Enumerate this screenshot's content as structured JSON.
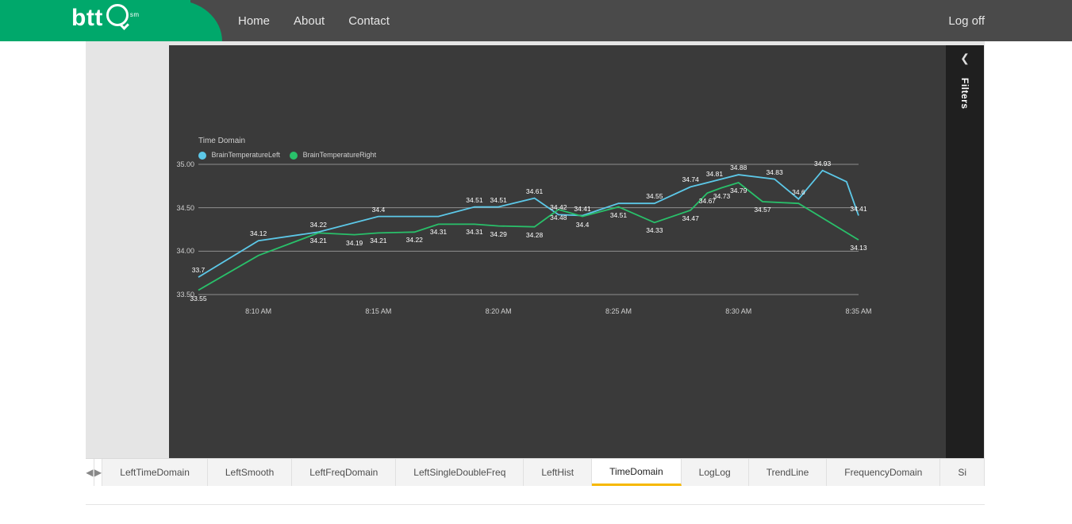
{
  "brand": {
    "text": "btt",
    "mark": "sm"
  },
  "nav": {
    "home": "Home",
    "about": "About",
    "contact": "Contact",
    "logoff": "Log off"
  },
  "filters": {
    "label": "Filters"
  },
  "tabs": {
    "items": [
      "LeftTimeDomain",
      "LeftSmooth",
      "LeftFreqDomain",
      "LeftSingleDoubleFreq",
      "LeftHist",
      "TimeDomain",
      "LogLog",
      "TrendLine",
      "FrequencyDomain",
      "Si"
    ],
    "active_index": 5
  },
  "chart_data": {
    "type": "line",
    "title": "Time Domain",
    "xlabel": "",
    "ylabel": "",
    "categories": [
      "8:10 AM",
      "8:15 AM",
      "8:20 AM",
      "8:25 AM",
      "8:30 AM",
      "8:35 AM"
    ],
    "x_minutes": [
      490,
      495,
      500,
      505,
      510,
      515
    ],
    "ylim": [
      33.5,
      35.0
    ],
    "yticks": [
      33.5,
      34.0,
      34.5,
      35.0
    ],
    "colors": {
      "BrainTemperatureLeft": "#5cc8e8",
      "BrainTemperatureRight": "#29c06a"
    },
    "series": [
      {
        "name": "BrainTemperatureLeft",
        "x": [
          487.5,
          490,
          492.5,
          495,
          497.5,
          499,
          500,
          501.5,
          502.5,
          503.5,
          505,
          506.5,
          508,
          509,
          510,
          511.5,
          512.5,
          513.5,
          514.5,
          515
        ],
        "values": [
          33.7,
          34.12,
          34.22,
          34.4,
          34.4,
          34.51,
          34.51,
          34.61,
          34.42,
          34.41,
          34.55,
          34.55,
          34.74,
          34.81,
          34.88,
          34.83,
          34.6,
          34.93,
          34.8,
          34.41
        ]
      },
      {
        "name": "BrainTemperatureRight",
        "x": [
          487.5,
          490,
          492.5,
          494,
          495,
          496.5,
          497.5,
          499,
          500,
          501.5,
          502.5,
          503.5,
          505,
          506.5,
          508,
          508.7,
          509.3,
          510,
          511,
          512.5,
          515
        ],
        "values": [
          33.55,
          33.95,
          34.21,
          34.19,
          34.21,
          34.22,
          34.31,
          34.31,
          34.29,
          34.28,
          34.48,
          34.4,
          34.51,
          34.33,
          34.47,
          34.67,
          34.73,
          34.79,
          34.57,
          34.55,
          34.13
        ]
      }
    ],
    "data_labels": [
      {
        "series": 0,
        "x": 487.5,
        "y": 33.7,
        "text": "33.7"
      },
      {
        "series": 0,
        "x": 490,
        "y": 34.12,
        "text": "34.12"
      },
      {
        "series": 0,
        "x": 492.5,
        "y": 34.22,
        "text": "34.22"
      },
      {
        "series": 0,
        "x": 495,
        "y": 34.4,
        "text": "34.4"
      },
      {
        "series": 0,
        "x": 499,
        "y": 34.51,
        "text": "34.51"
      },
      {
        "series": 0,
        "x": 500,
        "y": 34.51,
        "text": "34.51"
      },
      {
        "series": 0,
        "x": 501.5,
        "y": 34.61,
        "text": "34.61"
      },
      {
        "series": 0,
        "x": 502.5,
        "y": 34.42,
        "text": "34.42"
      },
      {
        "series": 0,
        "x": 503.5,
        "y": 34.41,
        "text": "34.41"
      },
      {
        "series": 0,
        "x": 506.5,
        "y": 34.55,
        "text": "34.55"
      },
      {
        "series": 0,
        "x": 508,
        "y": 34.74,
        "text": "34.74"
      },
      {
        "series": 0,
        "x": 509,
        "y": 34.81,
        "text": "34.81"
      },
      {
        "series": 0,
        "x": 510,
        "y": 34.88,
        "text": "34.88"
      },
      {
        "series": 0,
        "x": 511.5,
        "y": 34.83,
        "text": "34.83"
      },
      {
        "series": 0,
        "x": 512.5,
        "y": 34.6,
        "text": "34.6"
      },
      {
        "series": 0,
        "x": 513.5,
        "y": 34.93,
        "text": "34.93"
      },
      {
        "series": 0,
        "x": 515,
        "y": 34.41,
        "text": "34.41"
      },
      {
        "series": 1,
        "x": 487.5,
        "y": 33.55,
        "text": "33.55"
      },
      {
        "series": 1,
        "x": 492.5,
        "y": 34.21,
        "text": "34.21"
      },
      {
        "series": 1,
        "x": 494,
        "y": 34.19,
        "text": "34.19"
      },
      {
        "series": 1,
        "x": 495,
        "y": 34.21,
        "text": "34.21"
      },
      {
        "series": 1,
        "x": 496.5,
        "y": 34.22,
        "text": "34.22"
      },
      {
        "series": 1,
        "x": 497.5,
        "y": 34.31,
        "text": "34.31"
      },
      {
        "series": 1,
        "x": 499,
        "y": 34.31,
        "text": "34.31"
      },
      {
        "series": 1,
        "x": 500,
        "y": 34.29,
        "text": "34.29"
      },
      {
        "series": 1,
        "x": 501.5,
        "y": 34.28,
        "text": "34.28"
      },
      {
        "series": 1,
        "x": 502.5,
        "y": 34.48,
        "text": "34.48"
      },
      {
        "series": 1,
        "x": 503.5,
        "y": 34.4,
        "text": "34.4"
      },
      {
        "series": 1,
        "x": 505,
        "y": 34.51,
        "text": "34.51"
      },
      {
        "series": 1,
        "x": 506.5,
        "y": 34.33,
        "text": "34.33"
      },
      {
        "series": 1,
        "x": 508,
        "y": 34.47,
        "text": "34.47"
      },
      {
        "series": 1,
        "x": 508.7,
        "y": 34.67,
        "text": "34.67"
      },
      {
        "series": 1,
        "x": 509.3,
        "y": 34.73,
        "text": "34.73"
      },
      {
        "series": 1,
        "x": 510,
        "y": 34.79,
        "text": "34.79"
      },
      {
        "series": 1,
        "x": 511,
        "y": 34.57,
        "text": "34.57"
      },
      {
        "series": 1,
        "x": 515,
        "y": 34.13,
        "text": "34.13"
      }
    ]
  }
}
